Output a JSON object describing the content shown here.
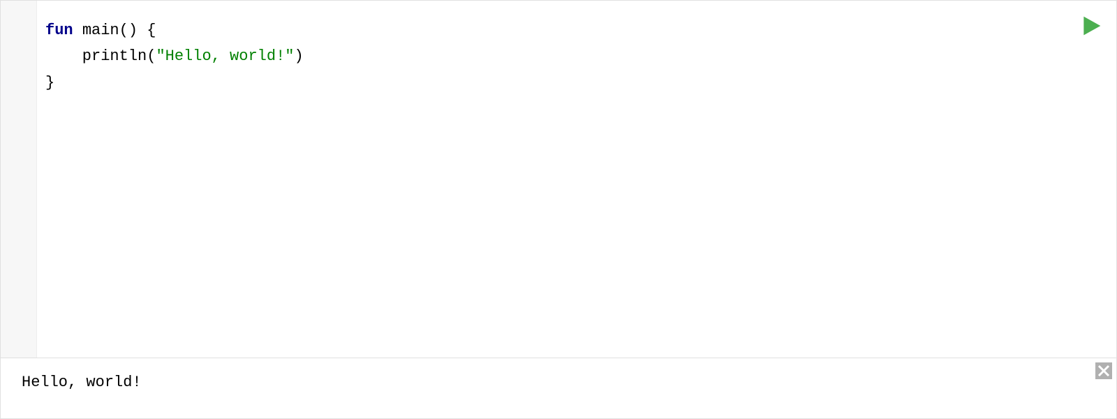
{
  "code": {
    "lines": [
      {
        "tokens": [
          {
            "text": "fun",
            "cls": "kw"
          },
          {
            "text": " ",
            "cls": ""
          },
          {
            "text": "main",
            "cls": "fn-name"
          },
          {
            "text": "() {",
            "cls": ""
          }
        ]
      },
      {
        "tokens": [
          {
            "text": "    println(",
            "cls": ""
          },
          {
            "text": "\"Hello, world!\"",
            "cls": "str"
          },
          {
            "text": ")",
            "cls": ""
          }
        ]
      },
      {
        "tokens": [
          {
            "text": "}",
            "cls": ""
          }
        ]
      }
    ]
  },
  "output": {
    "text": "Hello, world!"
  },
  "icons": {
    "run": "play-icon",
    "close": "close-icon"
  },
  "colors": {
    "keyword": "#00008b",
    "string": "#008000",
    "runIcon": "#4caf50",
    "closeIcon": "#b0b0b0"
  }
}
